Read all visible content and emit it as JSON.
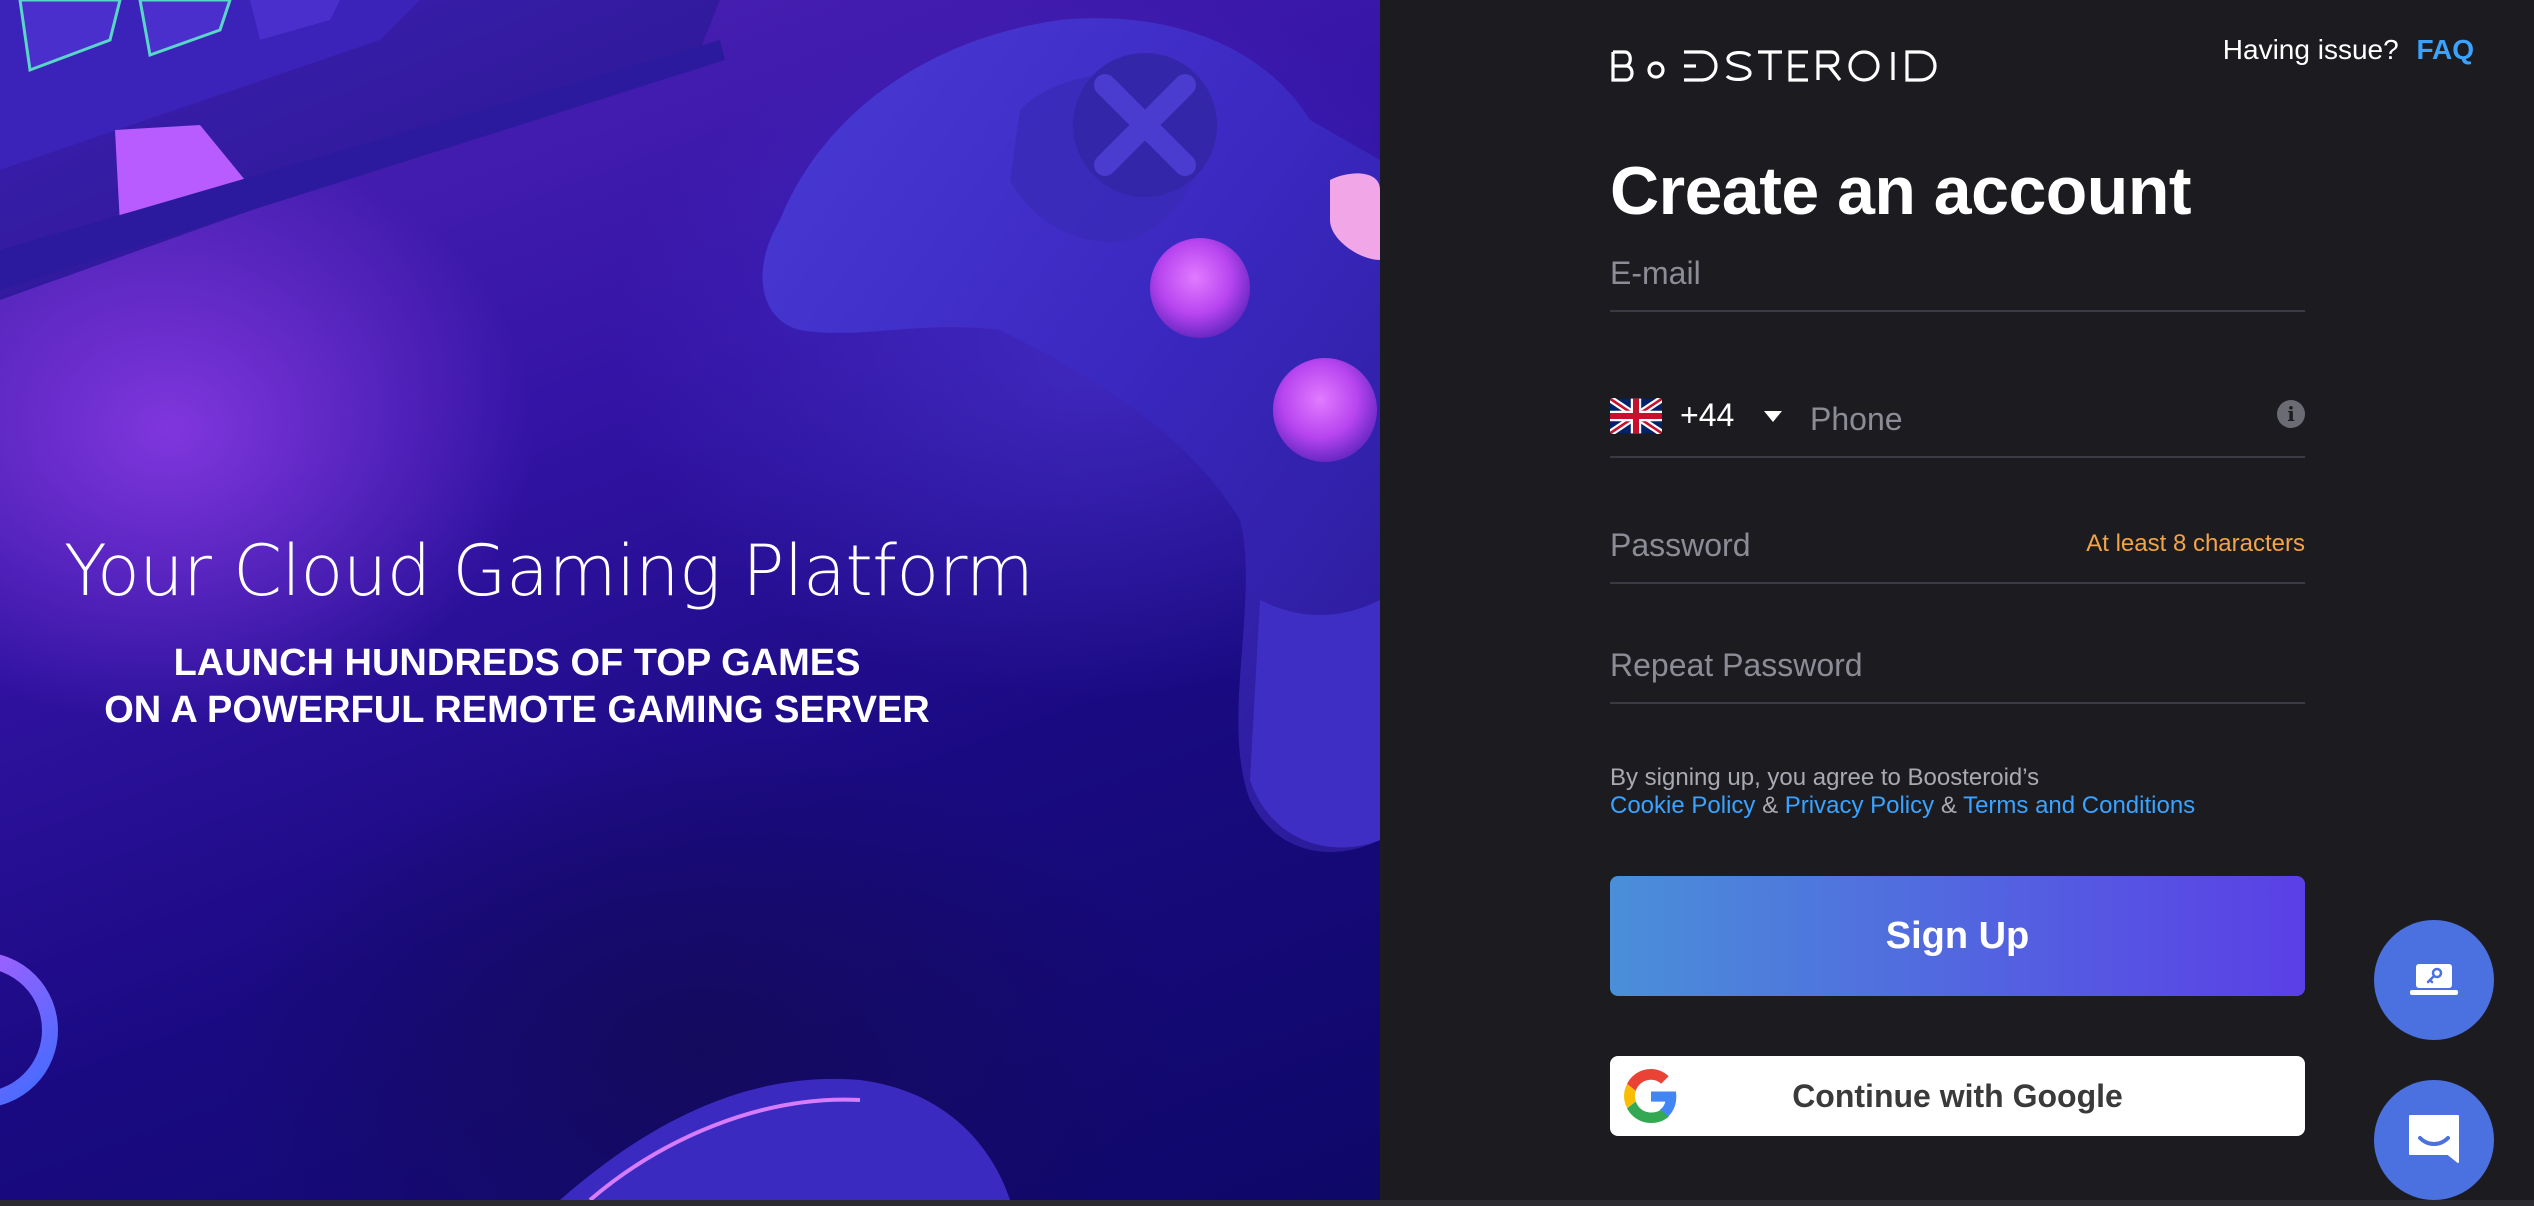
{
  "hero": {
    "title": "Your Cloud Gaming Platform",
    "subtitle_line1": "LAUNCH HUNDREDS OF TOP GAMES",
    "subtitle_line2": "ON A POWERFUL REMOTE GAMING SERVER"
  },
  "header": {
    "brand": "BOOSTEROID",
    "help_question": "Having issue?",
    "help_link": "FAQ"
  },
  "form": {
    "title": "Create an account",
    "email_placeholder": "E-mail",
    "phone_country_code": "+44",
    "phone_country_flag": "uk-flag-icon",
    "phone_placeholder": "Phone",
    "password_placeholder": "Password",
    "password_hint": "At least 8 characters",
    "repeat_password_placeholder": "Repeat Password",
    "terms_intro": "By signing up, you agree to Boosteroid’s",
    "cookie_policy": "Cookie Policy",
    "privacy_policy": "Privacy Policy",
    "terms_conditions": "Terms and Conditions",
    "separator": "&",
    "signup_label": "Sign Up",
    "google_label": "Continue with Google"
  },
  "colors": {
    "accent_link": "#3aa3ff",
    "hint": "#f2a447",
    "signup_gradient_start": "#4a8fd9",
    "signup_gradient_end": "#5a3fe6",
    "panel_bg": "#1c1c20",
    "fab": "#4b70e0"
  },
  "icons": {
    "remote_access_fab": "laptop-key-icon",
    "chat_fab": "chat-icon",
    "info": "info-icon",
    "google": "google-logo-icon"
  }
}
